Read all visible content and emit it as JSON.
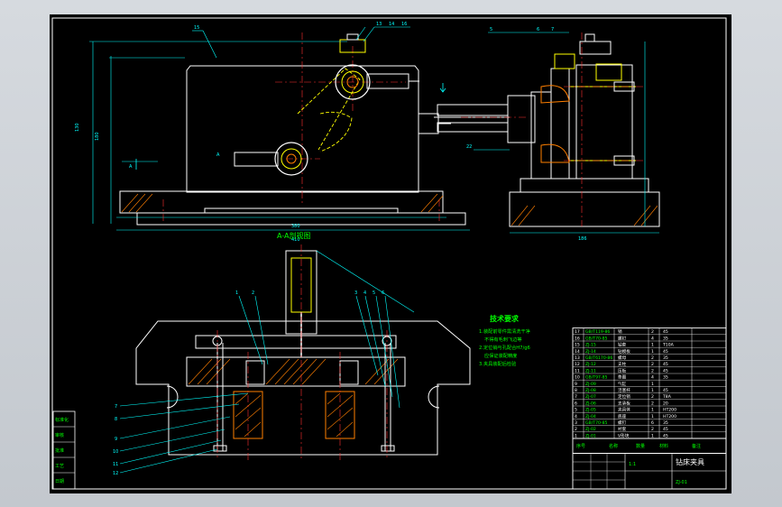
{
  "drawing": {
    "section_caption": "A-A剖视图",
    "tech_req": {
      "title": "技术要求",
      "lines": [
        "1.装配前零件需清洗干净",
        "不得有毛刺飞边等",
        "2.定位销与孔配合H7/g6",
        "应保证装配精度",
        "3.夹具装配后检验"
      ]
    },
    "callouts": [
      "1",
      "2",
      "3",
      "4",
      "5",
      "6",
      "7",
      "8",
      "9",
      "10",
      "11",
      "12"
    ],
    "left_block": {
      "labels": [
        "标准化",
        "审核",
        "批准",
        "工艺",
        "日期"
      ]
    },
    "title_block": {
      "part_name": "钻床夹具",
      "drawing_no": "ZJ-01",
      "scale": "1:1",
      "material_hdr": "材料",
      "qty_hdr": "数量",
      "name_hdr": "名称",
      "no_hdr": "序号",
      "remark_hdr": "备注"
    },
    "bom": [
      {
        "no": "17",
        "code": "GB/T119-86",
        "name": "销",
        "qty": "2",
        "mat": "45"
      },
      {
        "no": "16",
        "code": "GB/T70-85",
        "name": "螺钉",
        "qty": "4",
        "mat": "35"
      },
      {
        "no": "15",
        "code": "ZJ-15",
        "name": "钻套",
        "qty": "1",
        "mat": "T10A"
      },
      {
        "no": "14",
        "code": "ZJ-14",
        "name": "钻模板",
        "qty": "1",
        "mat": "45"
      },
      {
        "no": "13",
        "code": "GB/T6170-86",
        "name": "螺母",
        "qty": "2",
        "mat": "35"
      },
      {
        "no": "12",
        "code": "ZJ-12",
        "name": "支柱",
        "qty": "2",
        "mat": "45"
      },
      {
        "no": "11",
        "code": "ZJ-11",
        "name": "压板",
        "qty": "2",
        "mat": "45"
      },
      {
        "no": "10",
        "code": "GB/T97-85",
        "name": "垫圈",
        "qty": "4",
        "mat": "35"
      },
      {
        "no": "9",
        "code": "ZJ-09",
        "name": "气缸",
        "qty": "1",
        "mat": ""
      },
      {
        "no": "8",
        "code": "ZJ-08",
        "name": "活塞杆",
        "qty": "1",
        "mat": "45"
      },
      {
        "no": "7",
        "code": "ZJ-07",
        "name": "定位销",
        "qty": "2",
        "mat": "T8A"
      },
      {
        "no": "6",
        "code": "ZJ-06",
        "name": "支承板",
        "qty": "2",
        "mat": "20"
      },
      {
        "no": "5",
        "code": "ZJ-05",
        "name": "夹具体",
        "qty": "1",
        "mat": "HT200"
      },
      {
        "no": "4",
        "code": "ZJ-04",
        "name": "底座",
        "qty": "1",
        "mat": "HT200"
      },
      {
        "no": "3",
        "code": "GB/T70-85",
        "name": "螺钉",
        "qty": "6",
        "mat": "35"
      },
      {
        "no": "2",
        "code": "ZJ-02",
        "name": "衬套",
        "qty": "2",
        "mat": "45"
      },
      {
        "no": "1",
        "code": "ZJ-01",
        "name": "V形块",
        "qty": "1",
        "mat": "45"
      }
    ],
    "colors": {
      "outline": "#ffffff",
      "geometry": "#00ffff",
      "detail": "#ffff00",
      "centerline": "#ff3030",
      "hatch": "#ff7f00",
      "annot": "#00ff00"
    }
  }
}
